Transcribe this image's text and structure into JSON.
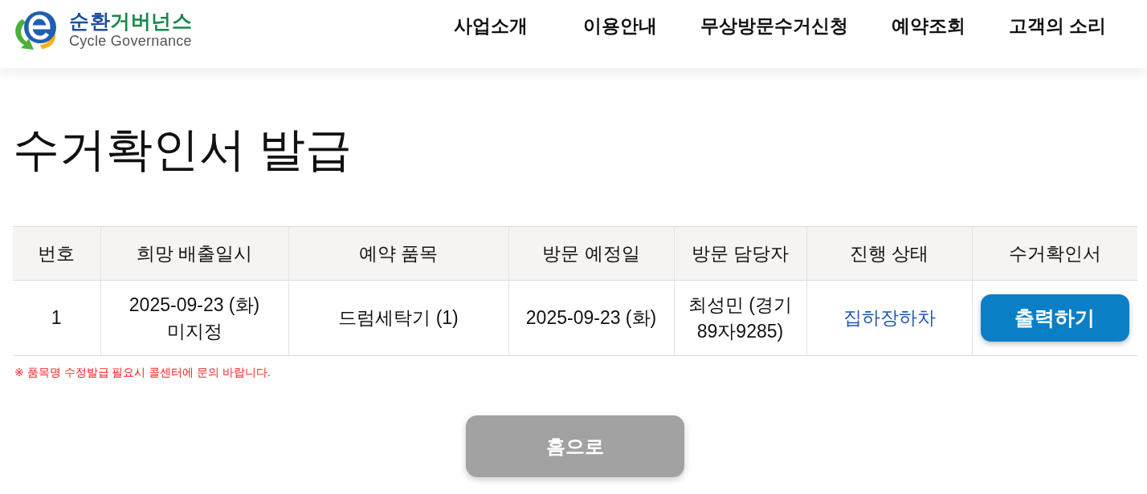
{
  "header": {
    "logo": {
      "name_parts": [
        "순환",
        "거버넌스"
      ],
      "subtitle": "Cycle Governance"
    },
    "nav": [
      "사업소개",
      "이용안내",
      "무상방문수거신청",
      "예약조회",
      "고객의 소리"
    ]
  },
  "page_title": "수거확인서 발급",
  "table": {
    "columns": [
      "번호",
      "희망 배출일시",
      "예약 품목",
      "방문 예정일",
      "방문 담당자",
      "진행 상태",
      "수거확인서"
    ],
    "rows": [
      {
        "cells": [
          {
            "kind": "text",
            "text": "1"
          },
          {
            "kind": "text",
            "text": "2025-09-23 (화) 미지정"
          },
          {
            "kind": "text",
            "text": "드럼세탁기 (1)"
          },
          {
            "kind": "text",
            "text": "2025-09-23 (화)"
          },
          {
            "kind": "text",
            "text": "최성민 (경기 89자9285)"
          },
          {
            "kind": "status",
            "text": "집하장하차"
          },
          {
            "kind": "button",
            "text": "출력하기"
          }
        ]
      }
    ]
  },
  "notice": "※ 품목명 수정발급 필요시 콜센터에 문의 바랍니다.",
  "home_button": "홈으로"
}
